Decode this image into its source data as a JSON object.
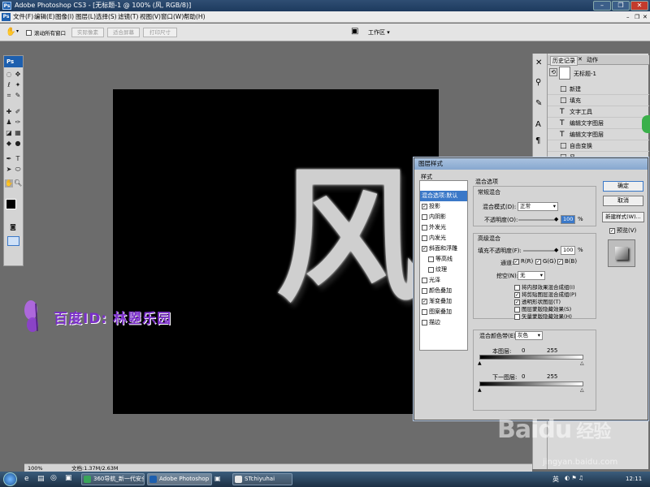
{
  "window": {
    "title": "Adobe Photoshop CS3 - [无标题-1 @ 100% (风, RGB/8)]",
    "app_icon": "Ps"
  },
  "menu": [
    "文件(F)",
    "编辑(E)",
    "图像(I)",
    "图层(L)",
    "选择(S)",
    "滤镜(T)",
    "视图(V)",
    "窗口(W)",
    "帮助(H)"
  ],
  "options_bar": {
    "scroll_all_label": "滚动所有窗口",
    "btn_actual": "实际像素",
    "btn_fit": "适合屏幕",
    "btn_print": "打印尺寸",
    "workspace": "工作区 ▾"
  },
  "toolbox_logo": "Ps",
  "canvas": {
    "glyph": "风"
  },
  "watermark": {
    "text": "百度ID: 林曌乐园"
  },
  "history": {
    "tab_history": "历史记录",
    "tab_actions": "动作",
    "snapshot": "无标题-1",
    "items": [
      {
        "icon": "□",
        "label": "新建"
      },
      {
        "icon": "□",
        "label": "填充"
      },
      {
        "icon": "T",
        "label": "文字工具"
      },
      {
        "icon": "T",
        "label": "编辑文字图层"
      },
      {
        "icon": "T",
        "label": "编辑文字图层"
      },
      {
        "icon": "□",
        "label": "自由变换"
      },
      {
        "icon": "□",
        "label": "风"
      }
    ]
  },
  "dialog": {
    "title": "图层样式",
    "styles_header": "样式",
    "styles": [
      {
        "label": "混合选项:默认",
        "checked": null,
        "selected": true
      },
      {
        "label": "投影",
        "checked": true
      },
      {
        "label": "内阴影",
        "checked": false
      },
      {
        "label": "外发光",
        "checked": false
      },
      {
        "label": "内发光",
        "checked": false
      },
      {
        "label": "斜面和浮雕",
        "checked": true
      },
      {
        "label": "等高线",
        "checked": false,
        "indent": true
      },
      {
        "label": "纹理",
        "checked": false,
        "indent": true
      },
      {
        "label": "光泽",
        "checked": false
      },
      {
        "label": "颜色叠加",
        "checked": false
      },
      {
        "label": "渐变叠加",
        "checked": true
      },
      {
        "label": "图案叠加",
        "checked": false
      },
      {
        "label": "描边",
        "checked": false
      }
    ],
    "blend_options": "混合选项",
    "general": "常规混合",
    "blend_mode_label": "混合模式(D):",
    "blend_mode_value": "正常",
    "opacity_label": "不透明度(O):",
    "opacity_value": "100",
    "percent": "%",
    "advanced": "高级混合",
    "fill_opacity_label": "填充不透明度(F):",
    "fill_opacity_value": "100",
    "channels_label": "通道:",
    "channel_r": "R(R)",
    "channel_g": "G(G)",
    "channel_b": "B(B)",
    "knockout_label": "挖空(N):",
    "knockout_value": "无",
    "opts": [
      {
        "label": "将内部效果混合成组(I)",
        "checked": false
      },
      {
        "label": "将剪贴图层混合成组(P)",
        "checked": true
      },
      {
        "label": "透明形状图层(T)",
        "checked": true
      },
      {
        "label": "图层蒙版隐藏效果(S)",
        "checked": false
      },
      {
        "label": "矢量蒙版隐藏效果(H)",
        "checked": false
      }
    ],
    "blend_if_label": "混合颜色带(E):",
    "blend_if_value": "灰色",
    "this_layer": "本图层:",
    "under_layer": "下一图层:",
    "v0": "0",
    "v255": "255",
    "btn_ok": "确定",
    "btn_cancel": "取消",
    "btn_new_style": "新建样式(W)...",
    "preview_label": "预览(V)"
  },
  "statusbar": {
    "zoom": "100%",
    "doc": "文档:1.37M/2.63M"
  },
  "taskbar": [
    {
      "label": "360导航_新一代安全...",
      "color": "#3aa55a"
    },
    {
      "label": "Adobe Photoshop ...",
      "color": "#1d5fae"
    },
    {
      "label": "STchiyuhai",
      "color": "#e8e8e8"
    }
  ],
  "tray": {
    "ime": "英",
    "clock": "12:11"
  },
  "baidu": {
    "brand": "Baidu",
    "jingyan": "经验",
    "url": "jingyan.baidu.com"
  }
}
